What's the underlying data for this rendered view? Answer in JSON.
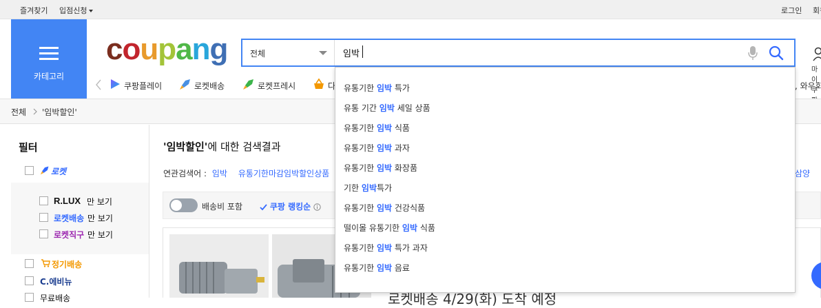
{
  "topbar": {
    "bookmark": "즐겨찾기",
    "seller_apply": "입점신청",
    "login": "로그인",
    "signup": "회원가입"
  },
  "header": {
    "category_label": "카테고리",
    "logo_letters": [
      {
        "ch": "c",
        "color": "#7b2e1f"
      },
      {
        "ch": "o",
        "color": "#c2252d"
      },
      {
        "ch": "u",
        "color": "#e89a2c"
      },
      {
        "ch": "p",
        "color": "#a3c439"
      },
      {
        "ch": "a",
        "color": "#50b848"
      },
      {
        "ch": "n",
        "color": "#29a6db"
      },
      {
        "ch": "g",
        "color": "#3f6fb4"
      }
    ],
    "mypage_label": "마이쿠팡"
  },
  "search": {
    "category_value": "전체",
    "query": "임박"
  },
  "shortcuts": [
    {
      "label": "쿠팡플레이",
      "icon": "coupang-play-icon"
    },
    {
      "label": "로켓배송",
      "icon": "rocket-icon"
    },
    {
      "label": "로켓프레시",
      "icon": "rocket-fresh-icon"
    },
    {
      "label": "다",
      "icon": "basket-icon"
    }
  ],
  "shortcuts_right": ", 와우회",
  "breadcrumb": {
    "root": "전체",
    "current": "'임박할인'"
  },
  "filter": {
    "title": "필터",
    "rocket": "로켓",
    "rlux_brand": "R.LUX",
    "only_view": "만 보기",
    "rocket_delivery": "로켓배송",
    "rocket_direct": "로켓직구",
    "regular_delivery": "정기배송",
    "e_number": "C.에비뉴",
    "free_shipping": "무료배송"
  },
  "results": {
    "keyword": "'임박할인'",
    "title_suffix": "에 대한 검색결과",
    "related_label": "연관검색어 :",
    "related": [
      "임박",
      "유통기한마감임박할인상품"
    ],
    "related_right": "삼양"
  },
  "toolbar": {
    "shipping_included": "배송비 포함",
    "ranking": "쿠팡 랭킹순"
  },
  "product_peek": {
    "delivery_text": "로켓배송 4/29(화) 도착 예정"
  },
  "suggestions": [
    {
      "pre": "유통기한 ",
      "hl": "임박",
      "post": " 특가"
    },
    {
      "pre": "유통 기간 ",
      "hl": "임박",
      "post": " 세일 상품"
    },
    {
      "pre": "유통기한 ",
      "hl": "임박",
      "post": " 식품"
    },
    {
      "pre": "유통기한 ",
      "hl": "임박",
      "post": " 과자"
    },
    {
      "pre": "유통기한 ",
      "hl": "임박",
      "post": " 화장품"
    },
    {
      "pre": "기한 ",
      "hl": "임박",
      "post": "특가"
    },
    {
      "pre": "유통기한 ",
      "hl": "임박",
      "post": " 건강식품"
    },
    {
      "pre": "떨이몰 유통기한 ",
      "hl": "임박",
      "post": " 식품"
    },
    {
      "pre": "유통기한 ",
      "hl": "임박",
      "post": " 특가 과자"
    },
    {
      "pre": "유통기한 ",
      "hl": "임박",
      "post": " 음료"
    }
  ],
  "colors": {
    "accent": "#4285f4",
    "link": "#346aff",
    "rocket_blue": "#346aff",
    "rocket_purple": "#9c27b0",
    "regular_orange": "#f39800"
  }
}
